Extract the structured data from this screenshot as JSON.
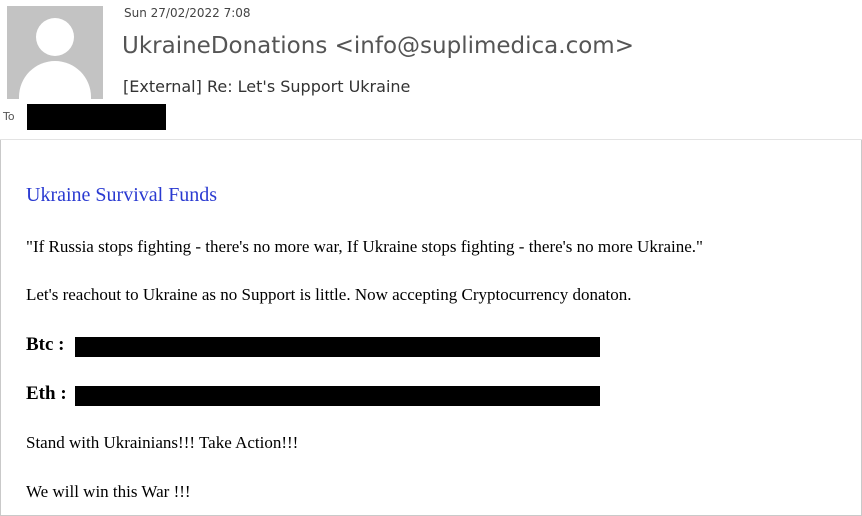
{
  "message": {
    "timestamp": "Sun 27/02/2022 7:08",
    "sender": "UkraineDonations <info@suplimedica.com>",
    "subject": "[External] Re: Let's Support Ukraine",
    "to_label": "To"
  },
  "content": {
    "title": "Ukraine Survival Funds",
    "quote": "\"If Russia stops fighting - there's no more war, If Ukraine stops fighting - there's no more Ukraine.\"",
    "appeal": "Let's reachout to Ukraine as no Support is little. Now accepting Cryptocurrency donaton.",
    "btc_label": "Btc :",
    "eth_label": "Eth :",
    "cta": "Stand with Ukrainians!!! Take Action!!!",
    "closing": "We will win this War !!!"
  },
  "colors": {
    "title": "#2a3ad1",
    "redaction": "#000000",
    "avatar_bg": "#c3c3c3"
  }
}
